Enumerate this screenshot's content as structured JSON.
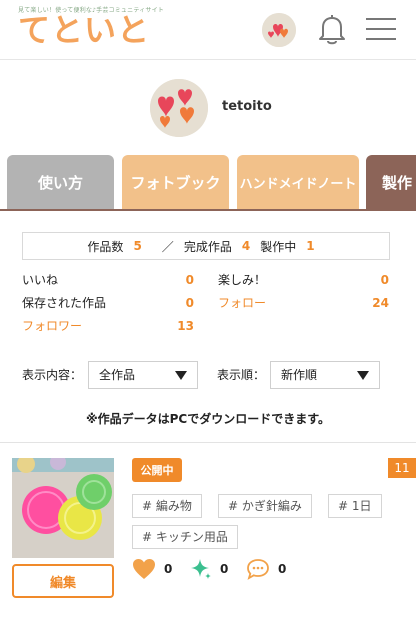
{
  "header": {
    "tagline": "見て楽しい！使って便利な♪手芸コミュニティサイト",
    "logo": "てといと",
    "colors": {
      "logo": "#f4a35c",
      "accent": "#f08a2a",
      "tab_brown": "#8c6458"
    }
  },
  "profile": {
    "username": "tetoito"
  },
  "tabs": [
    {
      "label": "使い方"
    },
    {
      "label": "フォトブック"
    },
    {
      "label": "ハンドメイドノート"
    },
    {
      "label": "製作"
    }
  ],
  "counts": {
    "works_label": "作品数",
    "works_value": "5",
    "separator": "／",
    "completed_label": "完成作品",
    "completed_value": "4",
    "in_progress_label": "製作中",
    "in_progress_value": "1"
  },
  "stats": {
    "like_label": "いいね",
    "like_value": "0",
    "looking_forward_label": "楽しみ！",
    "looking_forward_value": "0",
    "saved_label": "保存された作品",
    "saved_value": "0",
    "follow_label": "フォロー",
    "follow_value": "24",
    "follower_label": "フォロワー",
    "follower_value": "13"
  },
  "filters": {
    "display_label": "表示内容：",
    "display_value": "全作品",
    "order_label": "表示順：",
    "order_value": "新作順"
  },
  "download_note": "※作品データはPCでダウンロードできます。",
  "work": {
    "status": "公開中",
    "corner_badge": "11",
    "tags": [
      "# 編み物",
      "# かぎ針編み",
      "# 1日",
      "# キッチン用品"
    ],
    "edit_label": "編集",
    "reactions": {
      "likes": "0",
      "sparkle": "0",
      "comments": "0"
    }
  }
}
